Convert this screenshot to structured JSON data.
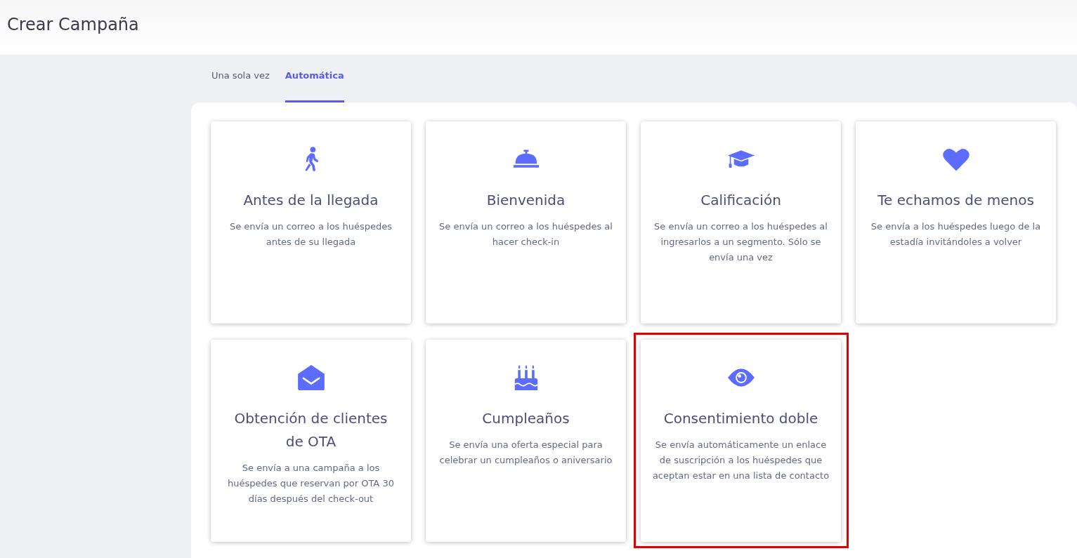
{
  "header": {
    "title": "Crear Campaña"
  },
  "tabs": [
    {
      "label": "Una sola vez",
      "selected": false
    },
    {
      "label": "Automática",
      "selected": true
    }
  ],
  "cards": [
    {
      "kind": "walker",
      "title": "Antes de la llegada",
      "description": "Se envía un correo a los huéspedes antes de su llegada",
      "highlighted": false
    },
    {
      "kind": "bell",
      "title": "Bienvenida",
      "description": "Se envía un correo a los huéspedes al hacer check-in",
      "highlighted": false
    },
    {
      "kind": "cap",
      "title": "Calificación",
      "description": "Se envía un correo a los huéspedes al ingresarlos a un segmento. Sólo se envía una vez",
      "highlighted": false
    },
    {
      "kind": "heart",
      "title": "Te echamos de menos",
      "description": "Se envía a los huéspedes luego de la estadía invitándoles a volver",
      "highlighted": false
    },
    {
      "kind": "envelope",
      "title": "Obtención de clientes de OTA",
      "description": "Se envía a una campaña a los huéspedes que reservan por OTA 30 días después del check-out",
      "highlighted": false
    },
    {
      "kind": "cake",
      "title": "Cumpleaños",
      "description": "Se envía una oferta especial para celebrar un cumpleaños o aniversario",
      "highlighted": false
    },
    {
      "kind": "eye",
      "title": "Consentimiento doble",
      "description": "Se envía automáticamente un enlace de suscripción a los huéspedes que aceptan estar en una lista de contacto",
      "highlighted": true
    }
  ]
}
